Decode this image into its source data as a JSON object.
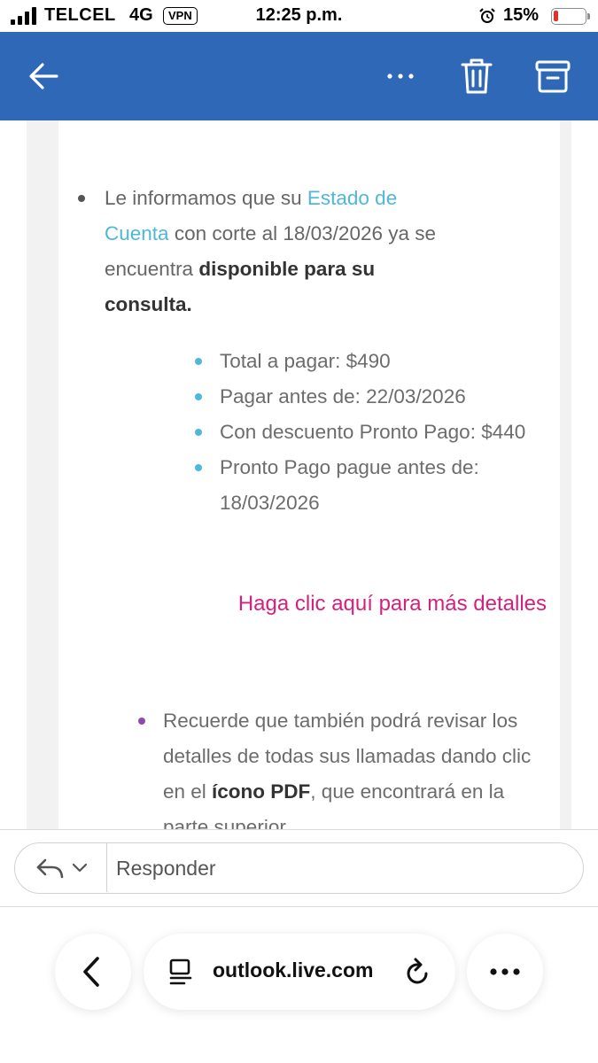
{
  "status_bar": {
    "carrier": "TELCEL",
    "network": "4G",
    "vpn": "VPN",
    "time": "12:25 p.m.",
    "battery_percent": "15%",
    "battery_level": 0.15,
    "battery_color": "#e0312f"
  },
  "header": {
    "background": "#2f68b6",
    "icons": [
      "back-arrow-icon",
      "more-icon",
      "trash-icon",
      "archive-icon"
    ]
  },
  "email": {
    "intro_text_1": "Le informamos que su ",
    "intro_link": "Estado de Cuenta",
    "intro_text_2": " con corte al 18/03/2026 ya se encuentra ",
    "intro_bold": "disponible para su consulta.",
    "details": [
      "Total a pagar: $490",
      "Pagar antes de: 22/03/2026",
      "Con descuento Pronto Pago: $440",
      "Pronto Pago pague antes de: 18/03/2026"
    ],
    "cta": "Haga clic aquí para más detalles",
    "second_text_1": "Recuerde que también podrá revisar los detalles de todas sus llamadas dando clic en el ",
    "second_bold": "ícono PDF",
    "second_text_2": ", que encontrará en la parte superior",
    "colors": {
      "link": "#4fb7d8",
      "cta": "#d6217c",
      "bullet_second": "#8e4aa8"
    }
  },
  "reply": {
    "placeholder": "Responder"
  },
  "browser": {
    "domain": "outlook.live.com"
  }
}
